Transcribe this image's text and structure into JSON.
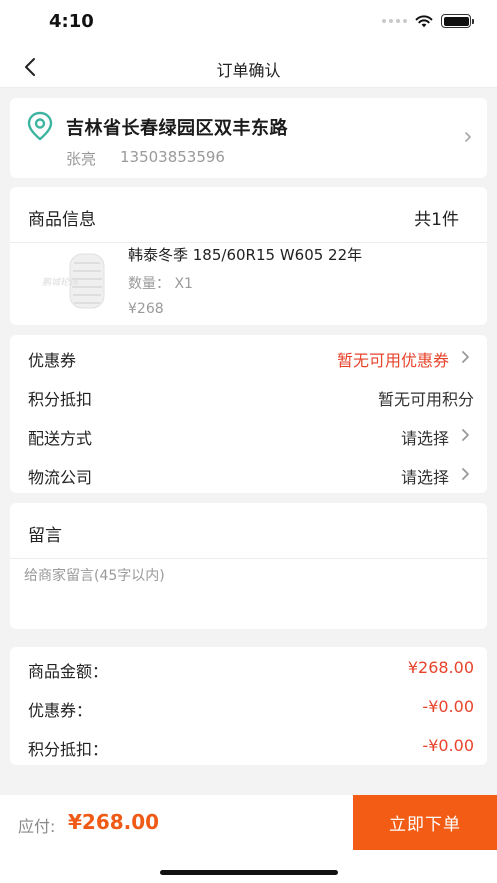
{
  "status_bar": {
    "time": "4:10"
  },
  "nav": {
    "title": "订单确认"
  },
  "address": {
    "full": "吉林省长春绿园区双丰东路",
    "name": "张亮",
    "phone": "13503853596"
  },
  "product": {
    "header_label": "商品信息",
    "count": "共1件",
    "name": "韩泰冬季 185/60R15  W605 22年",
    "quantity": "数量： X1",
    "price": "¥268",
    "thumb_watermark": "鹏城轮饰"
  },
  "options": [
    {
      "label": "优惠券",
      "value": "暂无可用优惠券",
      "accent": true,
      "chevron": true
    },
    {
      "label": "积分抵扣",
      "value": "暂无可用积分",
      "accent": false,
      "chevron": false
    },
    {
      "label": "配送方式",
      "value": "请选择",
      "accent": false,
      "chevron": true
    },
    {
      "label": "物流公司",
      "value": "请选择",
      "accent": false,
      "chevron": true
    }
  ],
  "message": {
    "title": "留言",
    "placeholder": "给商家留言(45字以内)",
    "value": ""
  },
  "summary": [
    {
      "label": "商品金额：",
      "value": "¥268.00"
    },
    {
      "label": "优惠券：",
      "value": "-¥0.00"
    },
    {
      "label": "积分抵扣：",
      "value": "-¥0.00"
    }
  ],
  "bottom": {
    "pay_label": "应付:",
    "pay_amount": "¥268.00",
    "submit_label": "立即下单"
  },
  "colors": {
    "accent": "#e8442c",
    "brand_orange": "#f25c14",
    "pin_green": "#3cb4a0"
  }
}
